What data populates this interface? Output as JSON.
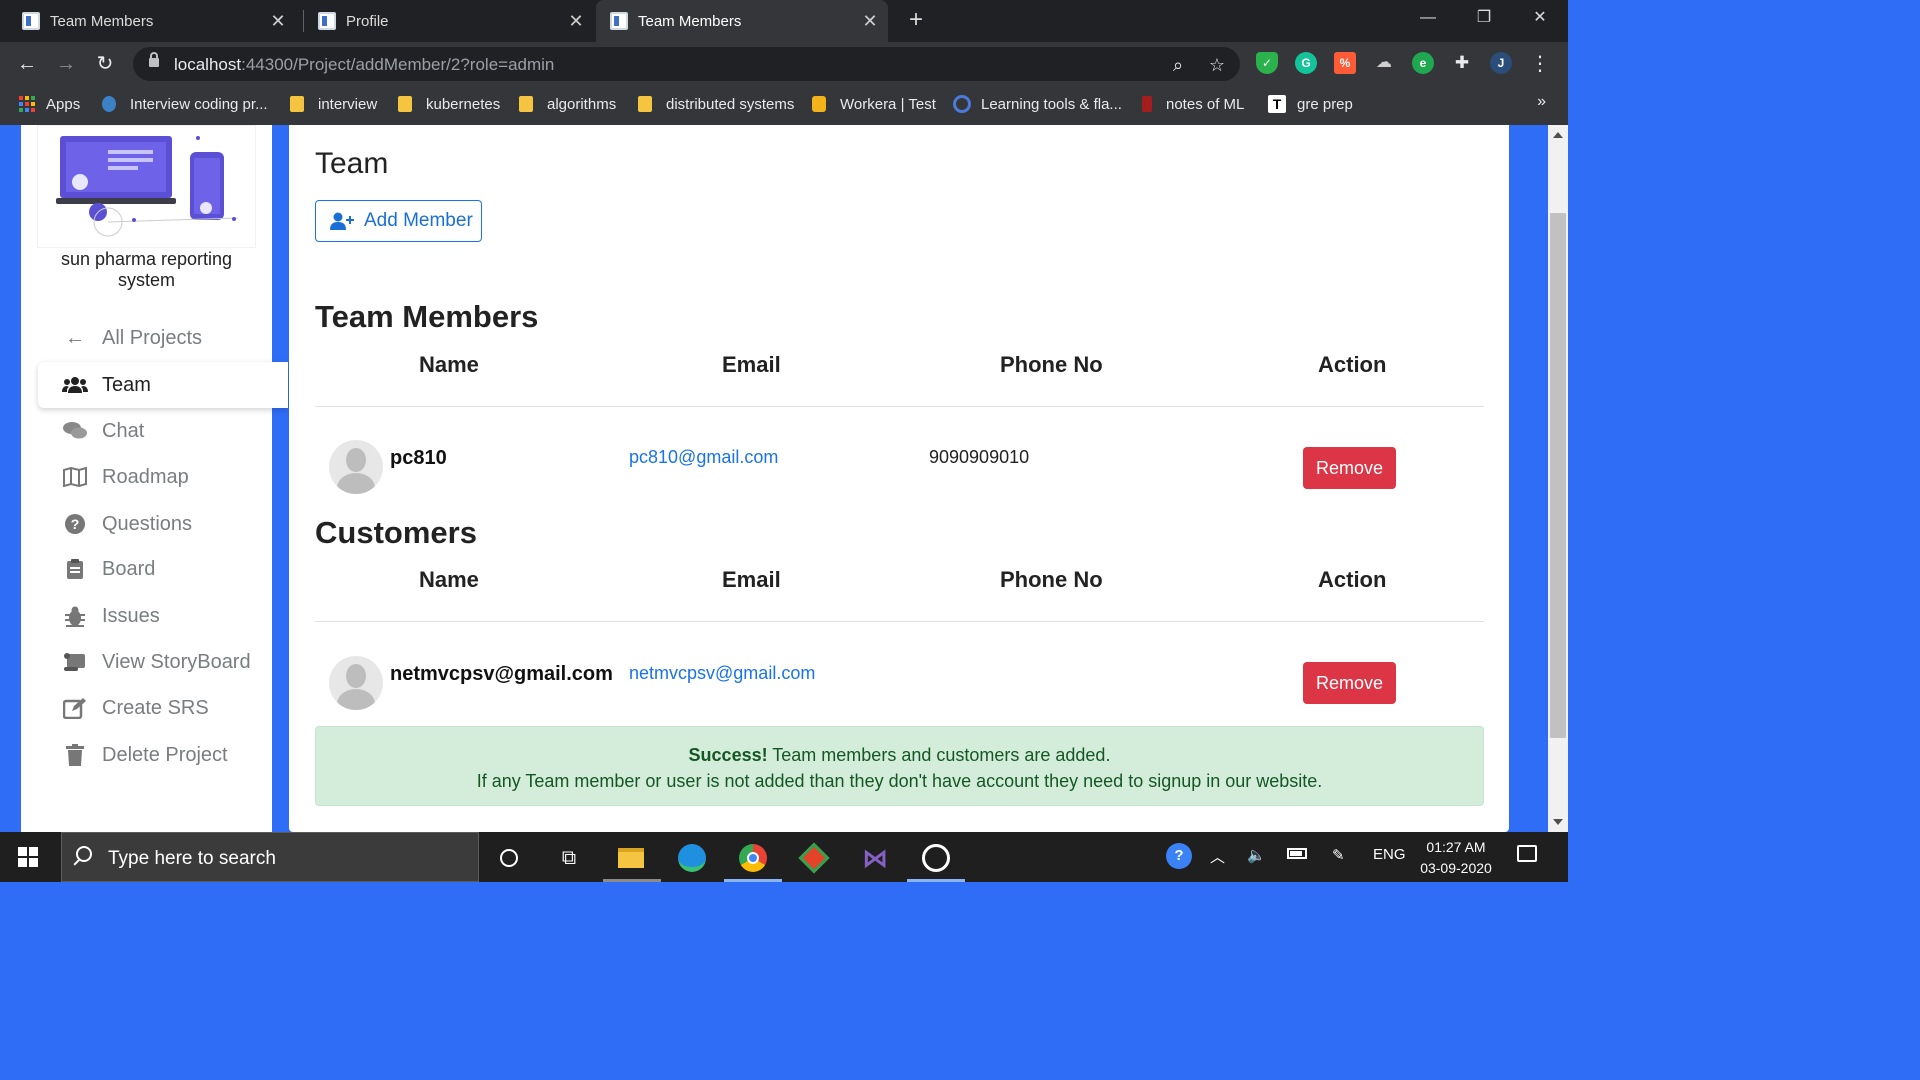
{
  "browser": {
    "tabs": [
      {
        "title": "Team Members",
        "active": false
      },
      {
        "title": "Profile",
        "active": false
      },
      {
        "title": "Team Members",
        "active": true
      }
    ],
    "url_host": "localhost",
    "url_path": ":44300/Project/addMember/2?role=admin",
    "bookmarks": [
      {
        "label": "Apps",
        "icon": "apps-grid-icon"
      },
      {
        "label": "Interview coding pr...",
        "icon": "site-icon"
      },
      {
        "label": "interview",
        "icon": "folder-icon"
      },
      {
        "label": "kubernetes",
        "icon": "folder-icon"
      },
      {
        "label": "algorithms",
        "icon": "folder-icon"
      },
      {
        "label": "distributed systems",
        "icon": "folder-icon"
      },
      {
        "label": "Workera | Test",
        "icon": "site-icon"
      },
      {
        "label": "Learning tools & fla...",
        "icon": "site-icon"
      },
      {
        "label": "notes of ML",
        "icon": "site-icon"
      },
      {
        "label": "gre prep",
        "icon": "site-icon"
      }
    ],
    "more_bookmarks": "»"
  },
  "sidebar": {
    "brand": "sun pharma reporting system",
    "items": [
      {
        "label": "All Projects",
        "icon": "arrow-left-icon",
        "active": false
      },
      {
        "label": "Team",
        "icon": "users-icon",
        "active": true
      },
      {
        "label": "Chat",
        "icon": "chat-icon",
        "active": false
      },
      {
        "label": "Roadmap",
        "icon": "map-icon",
        "active": false
      },
      {
        "label": "Questions",
        "icon": "question-icon",
        "active": false
      },
      {
        "label": "Board",
        "icon": "clipboard-icon",
        "active": false
      },
      {
        "label": "Issues",
        "icon": "bug-icon",
        "active": false
      },
      {
        "label": "View StoryBoard",
        "icon": "scroll-icon",
        "active": false
      },
      {
        "label": "Create SRS",
        "icon": "edit-icon",
        "active": false
      },
      {
        "label": "Delete Project",
        "icon": "trash-icon",
        "active": false
      }
    ]
  },
  "main": {
    "title": "Team",
    "add_member_label": "Add Member",
    "team_section": {
      "heading": "Team Members",
      "columns": [
        "Name",
        "Email",
        "Phone No",
        "Action"
      ],
      "rows": [
        {
          "name": "pc810",
          "email": "pc810@gmail.com",
          "phone": "9090909010",
          "action": "Remove"
        }
      ]
    },
    "customers_section": {
      "heading": "Customers",
      "columns": [
        "Name",
        "Email",
        "Phone No",
        "Action"
      ],
      "rows": [
        {
          "name": "netmvcpsv@gmail.com",
          "email": "netmvcpsv@gmail.com",
          "phone": "",
          "action": "Remove"
        }
      ]
    },
    "alert": {
      "strong": "Success!",
      "line1": " Team members and customers are added.",
      "line2": "If any Team member or user is not added than they don't have account they need to signup in our website."
    }
  },
  "taskbar": {
    "search_placeholder": "Type here to search",
    "language": "ENG",
    "time": "01:27 AM",
    "date": "03-09-2020"
  },
  "colors": {
    "page_bg": "#2f6df6",
    "primary": "#1a73e8",
    "danger": "#dc3545",
    "success_bg": "#d4edda",
    "success_text": "#155724"
  }
}
